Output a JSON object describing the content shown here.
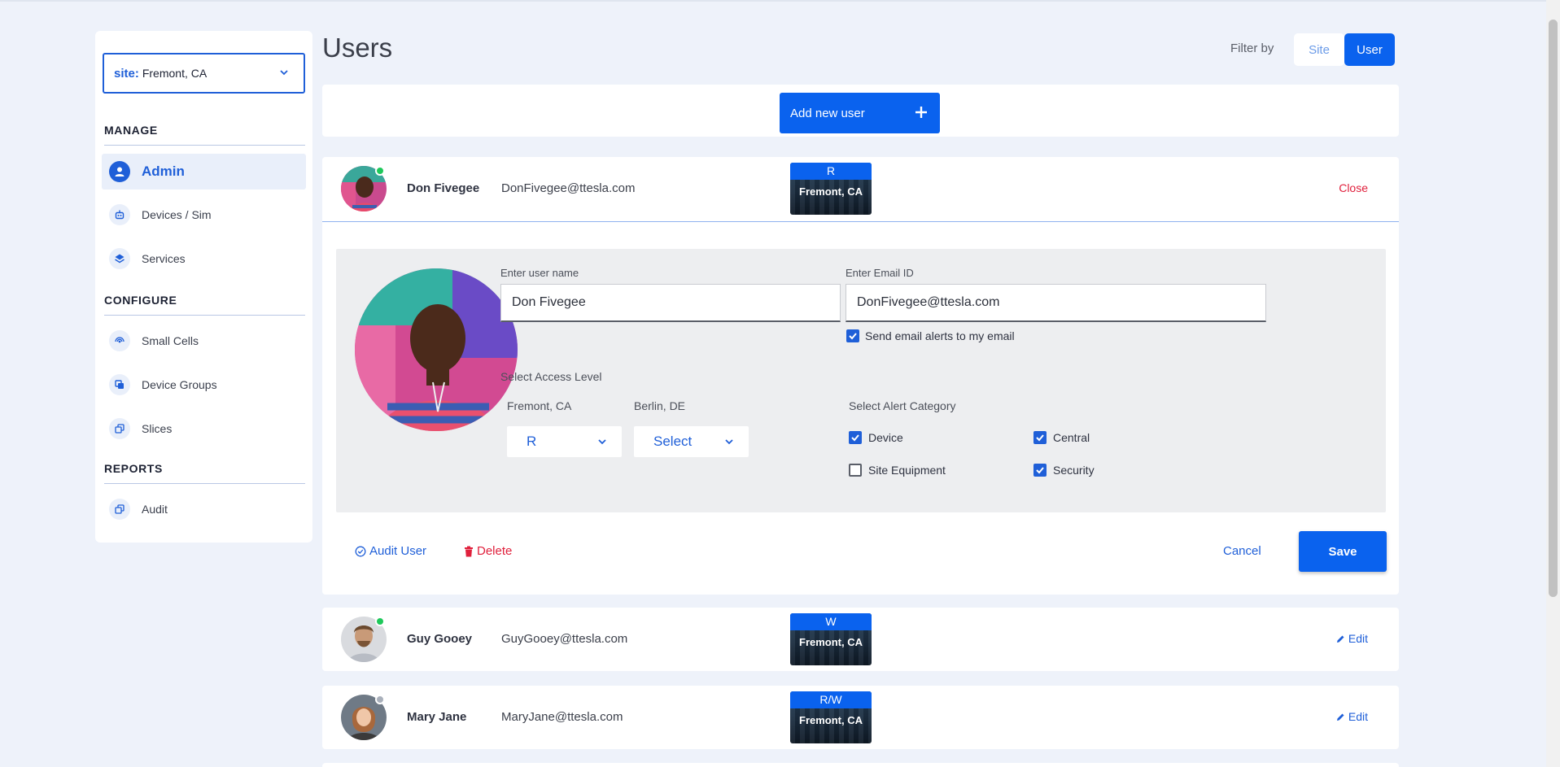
{
  "sidebar": {
    "site_selector": {
      "label": "site:",
      "value": "Fremont, CA"
    },
    "sections": [
      {
        "title": "MANAGE",
        "items": [
          {
            "label": "Admin",
            "icon": "person-icon",
            "active": true
          },
          {
            "label": "Devices / Sim",
            "icon": "robot-icon"
          },
          {
            "label": "Services",
            "icon": "layers-icon"
          }
        ]
      },
      {
        "title": "CONFIGURE",
        "items": [
          {
            "label": "Small Cells",
            "icon": "broadcast-icon"
          },
          {
            "label": "Device Groups",
            "icon": "copy-icon"
          },
          {
            "label": "Slices",
            "icon": "stack-icon"
          }
        ]
      },
      {
        "title": "REPORTS",
        "items": [
          {
            "label": "Audit",
            "icon": "stack-icon"
          }
        ]
      }
    ]
  },
  "header": {
    "title": "Users",
    "filter_label": "Filter by",
    "filter_options": [
      "Site",
      "User"
    ],
    "filter_selected": "User"
  },
  "add_user_label": "Add new user",
  "users": [
    {
      "name": "Don Fivegee",
      "email": "DonFivegee@ttesla.com",
      "access": "R",
      "site": "Fremont, CA",
      "status": "online",
      "action": "Close"
    },
    {
      "name": "Guy Gooey",
      "email": "GuyGooey@ttesla.com",
      "access": "W",
      "site": "Fremont, CA",
      "status": "online",
      "action": "Edit"
    },
    {
      "name": "Mary Jane",
      "email": "MaryJane@ttesla.com",
      "access": "R/W",
      "site": "Fremont, CA",
      "status": "offline",
      "action": "Edit"
    }
  ],
  "edit_form": {
    "username_label": "Enter user name",
    "username_value": "Don Fivegee",
    "email_label": "Enter Email ID",
    "email_value": "DonFivegee@ttesla.com",
    "email_alerts_label": "Send email alerts to my email",
    "email_alerts_checked": true,
    "access_level_title": "Select Access Level",
    "access_sites": [
      {
        "site": "Fremont, CA",
        "value": "R"
      },
      {
        "site": "Berlin, DE",
        "value": "Select"
      }
    ],
    "alert_category_title": "Select Alert Category",
    "alert_categories": [
      {
        "label": "Device",
        "checked": true
      },
      {
        "label": "Central",
        "checked": true
      },
      {
        "label": "Site Equipment",
        "checked": false
      },
      {
        "label": "Security",
        "checked": true
      }
    ],
    "audit_user_label": "Audit User",
    "delete_label": "Delete",
    "cancel_label": "Cancel",
    "save_label": "Save"
  },
  "colors": {
    "accent": "#0a62ee",
    "danger": "#e0203c",
    "online": "#1ec85a",
    "offline": "#a9b0bb"
  }
}
